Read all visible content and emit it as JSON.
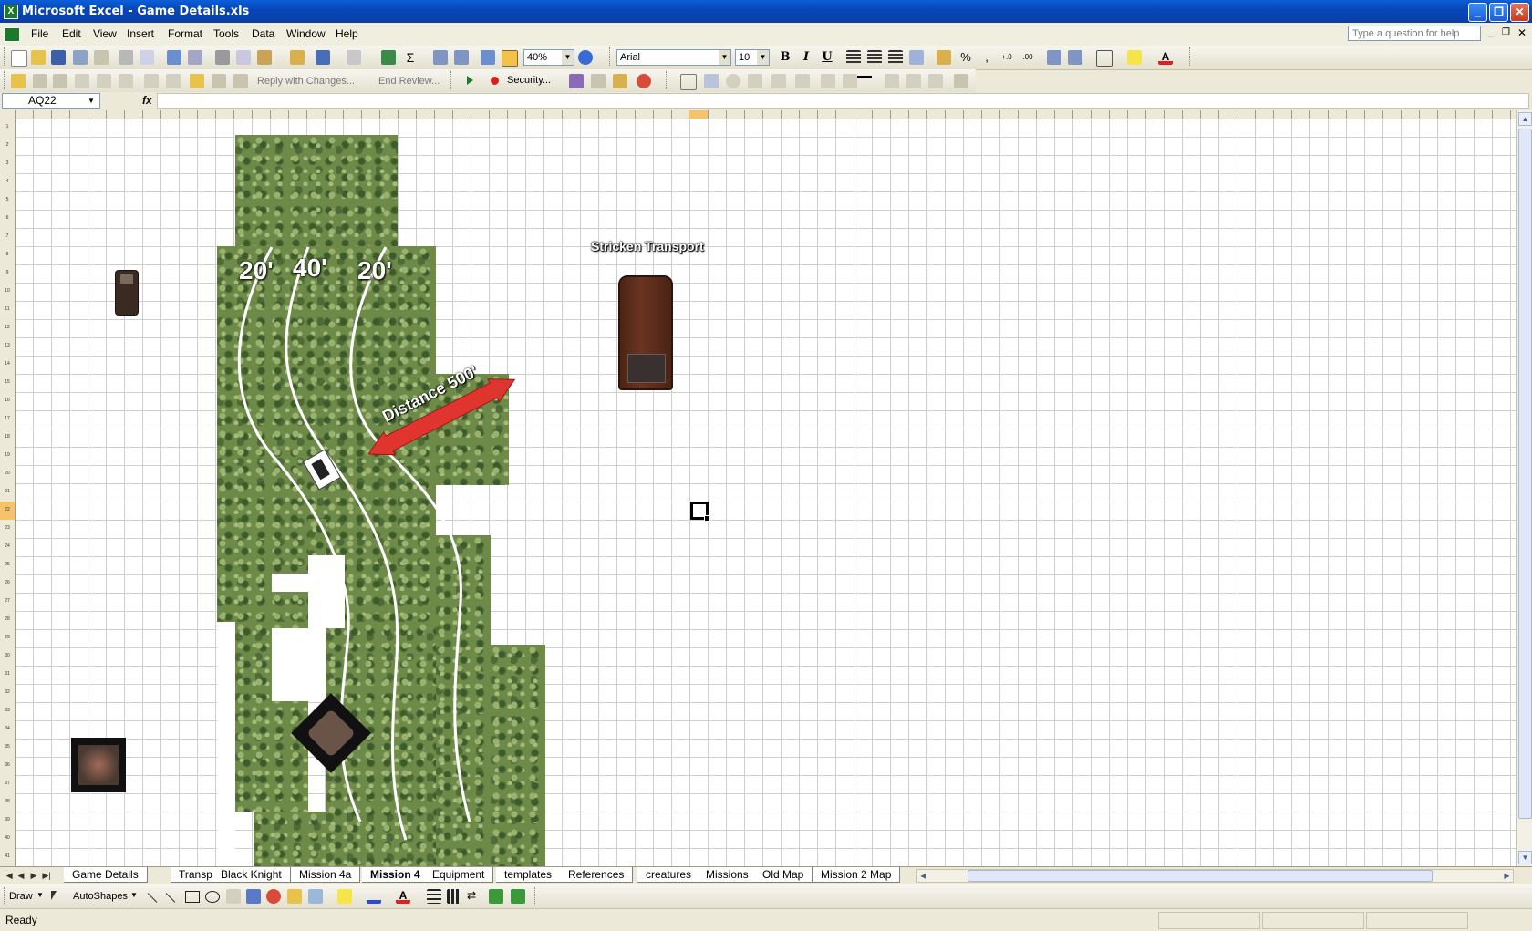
{
  "window": {
    "title": "Microsoft Excel - Game Details.xls",
    "app_icon": "excel-icon"
  },
  "menu": {
    "items": [
      "File",
      "Edit",
      "View",
      "Insert",
      "Format",
      "Tools",
      "Data",
      "Window",
      "Help"
    ],
    "help_box_placeholder": "Type a question for help"
  },
  "toolbar": {
    "zoom": "40%",
    "font": "Arial",
    "font_size": "10",
    "bold": "B",
    "italic": "I",
    "underline": "U",
    "percent": "%",
    "comma": ",",
    "reply_label": "Reply with Changes...",
    "end_review_label": "End Review...",
    "security_label": "Security..."
  },
  "formula_bar": {
    "name_box": "AQ22",
    "fx": "fx",
    "value": ""
  },
  "sheet": {
    "row_numbers": [
      "1",
      "2",
      "3",
      "4",
      "5",
      "6",
      "7",
      "8",
      "9",
      "10",
      "11",
      "12",
      "13",
      "14",
      "15",
      "16",
      "17",
      "18",
      "19",
      "20",
      "21",
      "22",
      "23",
      "24",
      "25",
      "26",
      "27",
      "28",
      "29",
      "30",
      "31",
      "32",
      "33",
      "34",
      "35",
      "36",
      "37",
      "38",
      "39",
      "40",
      "41"
    ],
    "selected_row": "22",
    "selected_col": "AQ",
    "path_labels": [
      "20'",
      "40'",
      "20'"
    ],
    "distance_label": "Distance 500'",
    "transport_label": "Stricken Transport"
  },
  "tabs": {
    "items": [
      "Game Details",
      "Transport",
      "Black Knight",
      "Mission 4a",
      "Mission 4",
      "Equipment",
      "templates",
      "References",
      "creatures",
      "Missions",
      "Old Map",
      "Mission 2 Map"
    ],
    "active_index": 4
  },
  "draw_toolbar": {
    "draw_label": "Draw",
    "autoshapes_label": "AutoShapes"
  },
  "status": {
    "text": "Ready"
  },
  "colors": {
    "titlebar": "#0846b8",
    "selection": "#f6c26b",
    "arrow": "#e0352f",
    "foliage": "#6d8a49"
  }
}
